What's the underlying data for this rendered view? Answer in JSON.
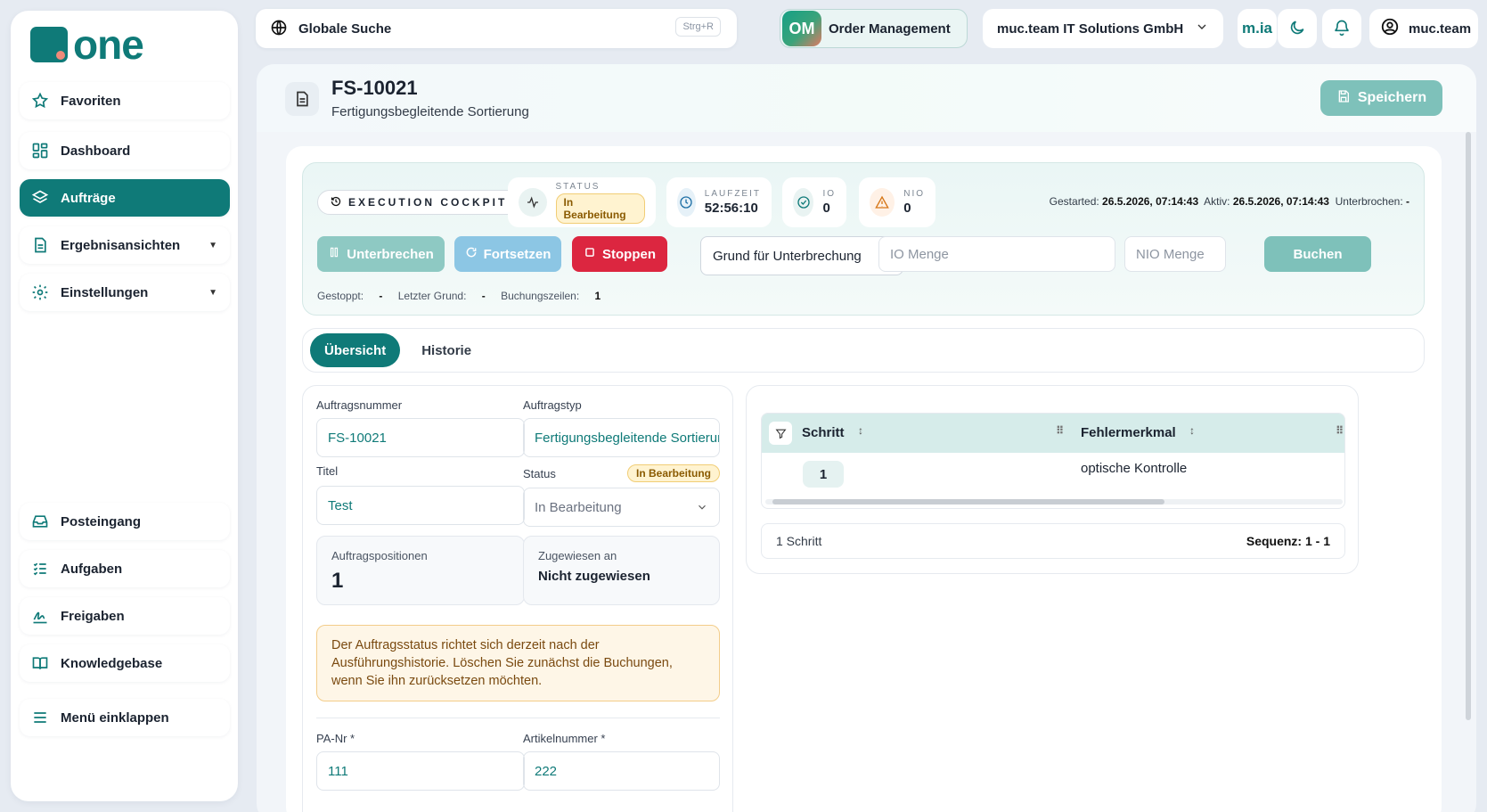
{
  "brand": {
    "logo_text": "one",
    "accent": "#0f7a78"
  },
  "topbar": {
    "search_label": "Globale Suche",
    "search_shortcut": "Strg+R",
    "app_badge": "OM",
    "app_name": "Order Management",
    "company": "muc.team IT Solutions GmbH",
    "mia": "m.ia",
    "user": "muc.team"
  },
  "sidebar": {
    "favorites": "Favoriten",
    "dashboard": "Dashboard",
    "orders": "Aufträge",
    "results": "Ergebnisansichten",
    "settings": "Einstellungen",
    "inbox": "Posteingang",
    "tasks": "Aufgaben",
    "approvals": "Freigaben",
    "knowledgebase": "Knowledgebase",
    "collapse": "Menü einklappen"
  },
  "header": {
    "title": "FS-10021",
    "subtitle": "Fertigungsbegleitende Sortierung",
    "save_label": "Speichern"
  },
  "cockpit": {
    "label": "EXECUTION COCKPIT",
    "status_label": "STATUS",
    "status_value": "In Bearbeitung",
    "runtime_label": "LAUFZEIT",
    "runtime_value": "52:56:10",
    "io_label": "IO",
    "io_value": "0",
    "nio_label": "NIO",
    "nio_value": "0",
    "started_label": "Gestarted:",
    "started_value": "26.5.2026, 07:14:43",
    "active_label": "Aktiv:",
    "active_value": "26.5.2026, 07:14:43",
    "interrupted_label": "Unterbrochen:",
    "interrupted_value": "-",
    "btn_interrupt": "Unterbrechen",
    "btn_resume": "Fortsetzen",
    "btn_stop": "Stoppen",
    "reason_placeholder": "Grund für Unterbrechung",
    "io_qty_placeholder": "IO Menge",
    "nio_qty_placeholder": "NIO Menge",
    "btn_book": "Buchen",
    "stopped_label": "Gestoppt:",
    "stopped_value": "-",
    "last_reason_label": "Letzter Grund:",
    "last_reason_value": "-",
    "booking_lines_label": "Buchungszeilen:",
    "booking_lines_value": "1"
  },
  "tabs": {
    "overview": "Übersicht",
    "history": "Historie"
  },
  "form": {
    "order_no_label": "Auftragsnummer",
    "order_no_value": "FS-10021",
    "order_type_label": "Auftragstyp",
    "order_type_value": "Fertigungsbegleitende Sortierung",
    "title_label": "Titel",
    "title_value": "Test",
    "status_label": "Status",
    "status_badge": "In Bearbeitung",
    "status_value": "In Bearbeitung",
    "positions_label": "Auftragspositionen",
    "positions_value": "1",
    "assigned_label": "Zugewiesen an",
    "assigned_value": "Nicht zugewiesen",
    "notice": "Der Auftragsstatus richtet sich derzeit nach der Ausführungshistorie. Löschen Sie zunächst die Buchungen, wenn Sie ihn zurücksetzen möchten.",
    "pa_label": "PA-Nr *",
    "pa_value": "111",
    "article_label": "Artikelnummer *",
    "article_value": "222"
  },
  "steps": {
    "col_step": "Schritt",
    "col_defect": "Fehlermerkmal",
    "rows": [
      {
        "step": "1",
        "defect": "optische Kontrolle"
      }
    ],
    "count_text": "1 Schritt",
    "sequence_text": "Sequenz: 1 - 1"
  }
}
